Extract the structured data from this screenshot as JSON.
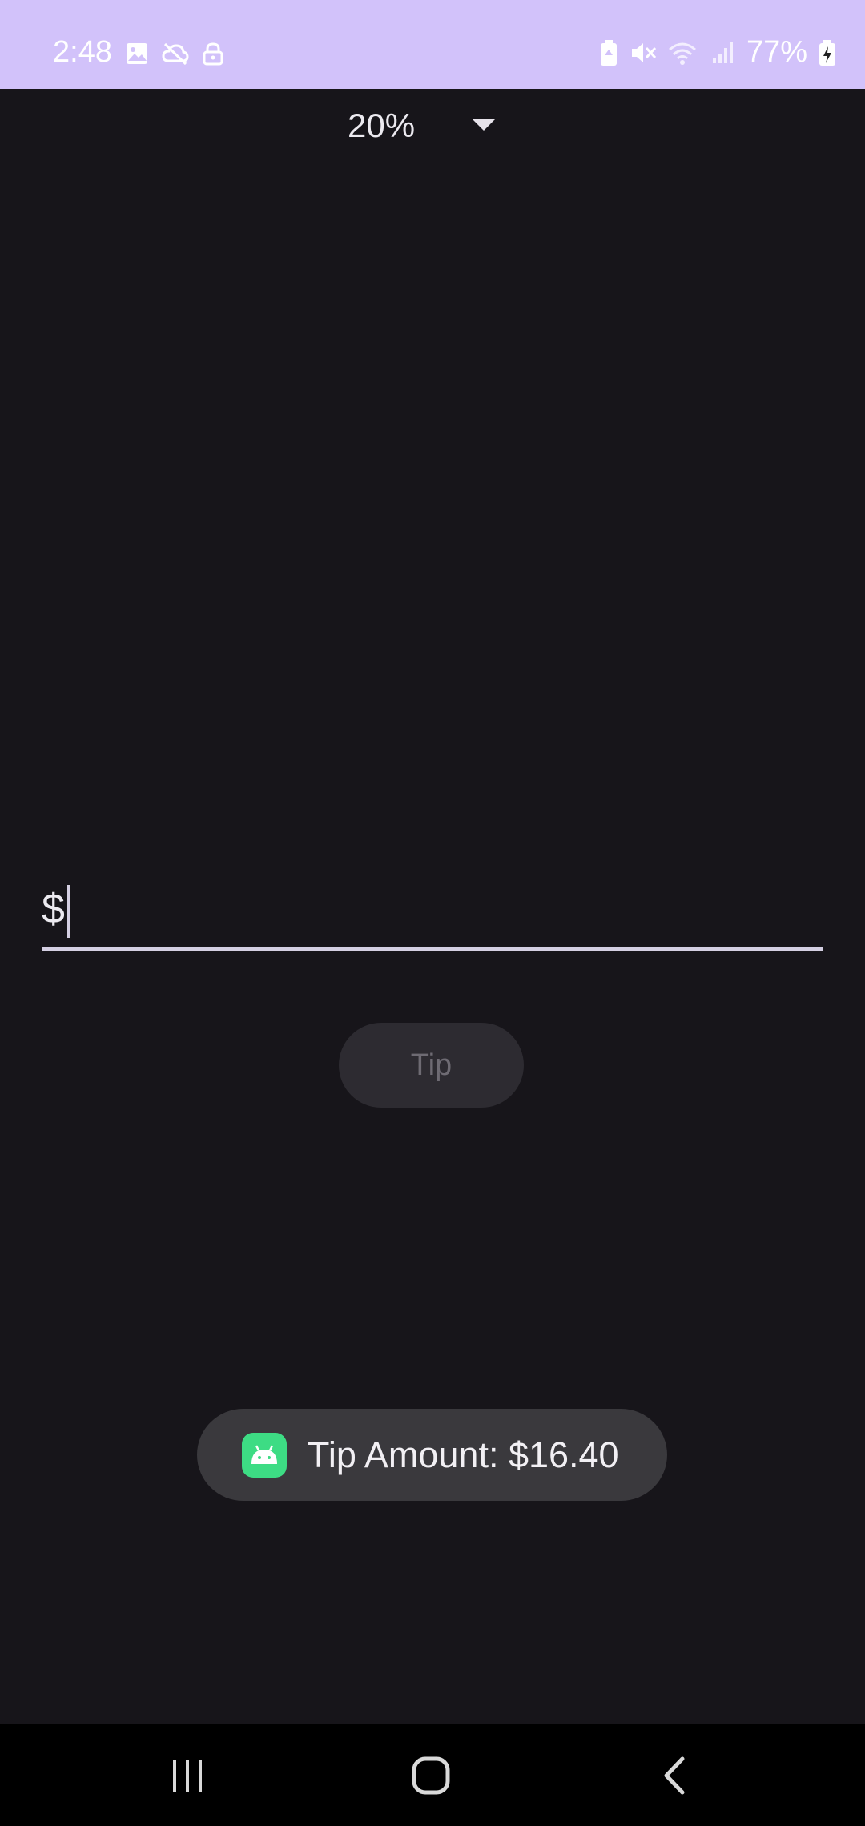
{
  "status_bar": {
    "time": "2:48",
    "battery_text": "77%",
    "left_icons": [
      "image-icon",
      "cloud-off-icon",
      "lock-icon"
    ],
    "right_icons": [
      "battery-saver-icon",
      "vibrate-mute-icon",
      "wifi-icon",
      "signal-icon",
      "battery-charging-icon"
    ]
  },
  "app": {
    "tip_percentage": {
      "selected": "20%"
    },
    "amount_field": {
      "prefix": "$",
      "value": ""
    },
    "tip_button": {
      "label": "Tip"
    }
  },
  "toast": {
    "icon": "android-icon",
    "text": "Tip Amount: $16.40"
  },
  "navigation_bar": {
    "buttons": [
      "recents-icon",
      "home-icon",
      "back-icon"
    ]
  },
  "colors": {
    "status_bar_bg": "#d2c2fa",
    "app_bg": "#17151a",
    "toast_bg": "#3a393d",
    "android_green": "#3ddc84"
  }
}
